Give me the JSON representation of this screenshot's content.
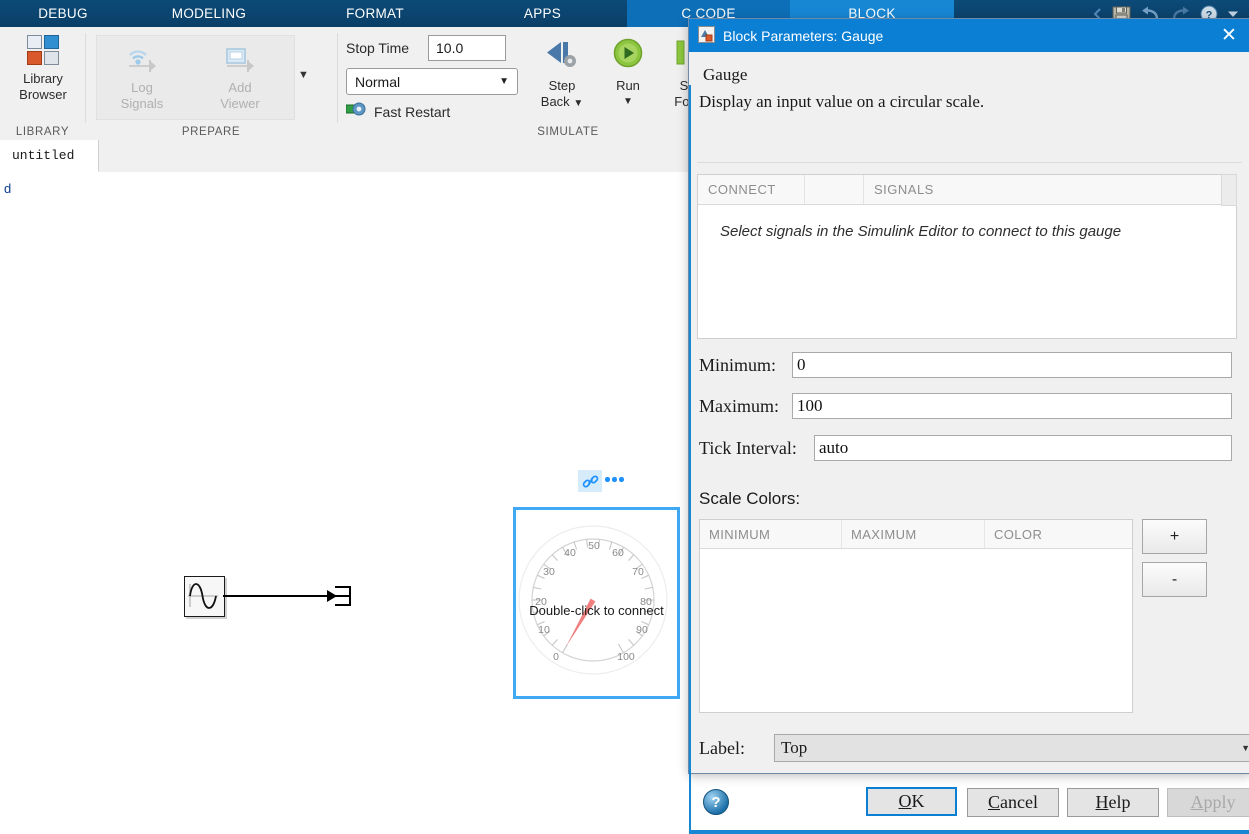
{
  "app": {
    "ribbon_tabs": [
      {
        "label": "DEBUG",
        "state": "normal"
      },
      {
        "label": "MODELING",
        "state": "normal"
      },
      {
        "label": "FORMAT",
        "state": "normal"
      },
      {
        "label": "APPS",
        "state": "normal"
      },
      {
        "label": "C CODE",
        "state": "selected"
      },
      {
        "label": "BLOCK",
        "state": "active"
      }
    ],
    "quick_access": [
      {
        "name": "save-icon",
        "label": "Save"
      },
      {
        "name": "undo-icon",
        "label": "Undo"
      },
      {
        "name": "redo-icon",
        "label": "Redo"
      },
      {
        "name": "help-icon",
        "label": "Help"
      },
      {
        "name": "chevron-down-icon",
        "label": "More"
      }
    ]
  },
  "ribbon": {
    "groups": [
      {
        "label": "LIBRARY"
      },
      {
        "label": "PREPARE"
      },
      {
        "label": "SIMULATE"
      }
    ],
    "library_browser": {
      "line1": "Library",
      "line2": "Browser"
    },
    "log_signals": {
      "line1": "Log",
      "line2": "Signals",
      "enabled": false
    },
    "add_viewer": {
      "line1": "Add",
      "line2": "Viewer",
      "enabled": false
    },
    "prepare_more": "▼",
    "stop_time": {
      "label": "Stop Time",
      "value": "10.0"
    },
    "sim_mode": {
      "value": "Normal"
    },
    "fast_restart": {
      "label": "Fast Restart"
    },
    "step_back": {
      "line1": "Step",
      "line2": "Back"
    },
    "run": {
      "label": "Run"
    },
    "step_forward": {
      "line1": "S",
      "line2": "For"
    }
  },
  "model": {
    "tab_label": "untitled",
    "breadcrumb": "d"
  },
  "canvas": {
    "gauge_badges": {
      "link_icon": "link-icon",
      "dots": "ellipsis-icon"
    },
    "gauge": {
      "caption": "Double-click to connect",
      "tick_labels": [
        "0",
        "10",
        "20",
        "30",
        "40",
        "50",
        "60",
        "70",
        "80",
        "90",
        "100"
      ],
      "minimum": 0,
      "maximum": 100,
      "needle_value": 0,
      "needle_color": "#f08080"
    },
    "sine_block": {
      "name": "sine-wave-source"
    }
  },
  "dialog": {
    "title": "Block Parameters: Gauge",
    "close_label": "✕",
    "block_name": "Gauge",
    "description": "Display an input value on a circular scale.",
    "connect_table": {
      "columns": [
        "CONNECT",
        "",
        "SIGNALS"
      ],
      "empty_message": "Select signals in the Simulink Editor to connect to this gauge"
    },
    "fields": [
      {
        "label": "Minimum:",
        "value": "0"
      },
      {
        "label": "Maximum:",
        "value": "100"
      },
      {
        "label": "Tick Interval:",
        "value": "auto"
      }
    ],
    "scale_colors": {
      "label": "Scale Colors:",
      "columns": [
        "MINIMUM",
        "MAXIMUM",
        "COLOR"
      ],
      "rows": [],
      "add_button": "+",
      "remove_button": "-"
    },
    "label_field": {
      "label": "Label:",
      "value": "Top",
      "caret": "▼"
    },
    "buttons": [
      {
        "pre": "",
        "mn": "O",
        "post": "K",
        "state": "focused"
      },
      {
        "pre": "",
        "mn": "C",
        "post": "ancel",
        "state": "normal"
      },
      {
        "pre": "",
        "mn": "H",
        "post": "elp",
        "state": "normal"
      },
      {
        "pre": "",
        "mn": "A",
        "post": "pply",
        "state": "disabled"
      }
    ],
    "help_icon": "?"
  }
}
